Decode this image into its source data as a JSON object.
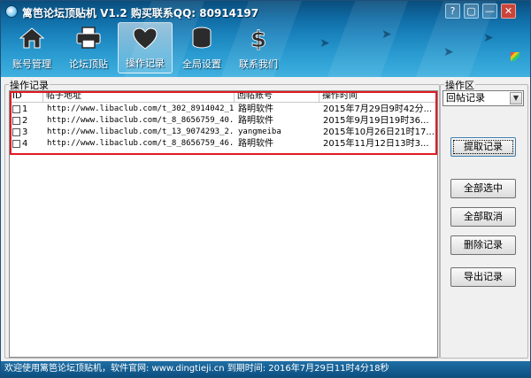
{
  "window": {
    "title": "篱笆论坛顶贴机 V1.2 购买联系QQ: 80914197",
    "controls": {
      "help": "?",
      "restore": "▢",
      "minimize": "—",
      "close": "✕"
    }
  },
  "toolbar": {
    "items": [
      {
        "label": "账号管理",
        "icon": "home-icon"
      },
      {
        "label": "论坛顶贴",
        "icon": "printer-icon"
      },
      {
        "label": "操作记录",
        "icon": "heart-icon",
        "active": true
      },
      {
        "label": "全局设置",
        "icon": "coins-icon"
      },
      {
        "label": "联系我们",
        "icon": "dollar-icon"
      }
    ]
  },
  "records": {
    "group_title": "操作记录",
    "columns": {
      "id": "ID",
      "url": "帖子地址",
      "account": "回帖账号",
      "time": "操作时间"
    },
    "rows": [
      {
        "id": "1",
        "url": "http://www.libaclub.com/t_302_8914042_1....",
        "account": "路明软件",
        "time": "2015年7月29日9时42分..."
      },
      {
        "id": "2",
        "url": "http://www.libaclub.com/t_8_8656759_40.h...",
        "account": "路明软件",
        "time": "2015年9月19日19时36..."
      },
      {
        "id": "3",
        "url": "http://www.libaclub.com/t_13_9074293_2.h...",
        "account": "yangmeiba",
        "time": "2015年10月26日21时17..."
      },
      {
        "id": "4",
        "url": "http://www.libaclub.com/t_8_8656759_46.h...",
        "account": "路明软件",
        "time": "2015年11月12日13时3..."
      }
    ]
  },
  "ops": {
    "group_title": "操作区",
    "select_value": "回帖记录",
    "buttons": {
      "fetch": "提取记录",
      "select_all": "全部选中",
      "cancel_all": "全部取消",
      "delete": "删除记录",
      "export": "导出记录"
    }
  },
  "status": {
    "text": "欢迎使用篱笆论坛顶贴机，软件官网: www.dingtieji.cn 到期时间: 2016年7月29日11时4分18秒"
  },
  "colors": {
    "banner_top": "#0a4d7c",
    "banner_bottom": "#3fb0df",
    "highlight_box": "#e01b24",
    "status_bar": "#0d4f80"
  }
}
